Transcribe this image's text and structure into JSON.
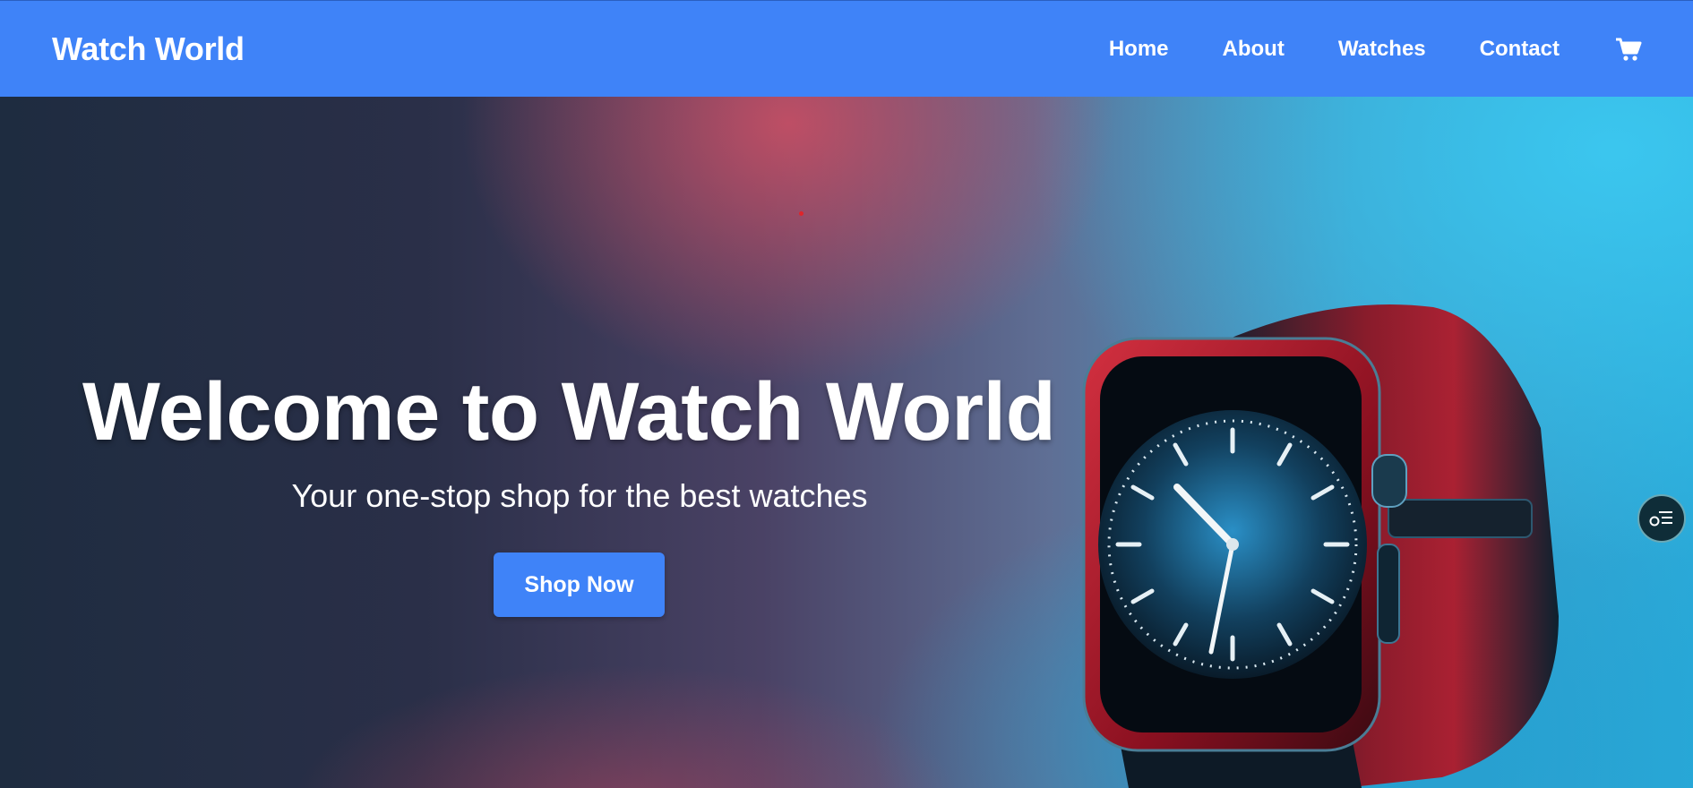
{
  "header": {
    "brand": "Watch World",
    "nav": [
      {
        "label": "Home"
      },
      {
        "label": "About"
      },
      {
        "label": "Watches"
      },
      {
        "label": "Contact"
      }
    ],
    "cart_icon": "shopping-cart-icon"
  },
  "hero": {
    "title": "Welcome to Watch World",
    "subtitle": "Your one-stop shop for the best watches",
    "cta_label": "Shop Now",
    "image": "smartwatch-illustration"
  },
  "widget": {
    "icon": "list-menu-icon"
  },
  "colors": {
    "primary": "#3f83f8",
    "text": "#ffffff"
  }
}
